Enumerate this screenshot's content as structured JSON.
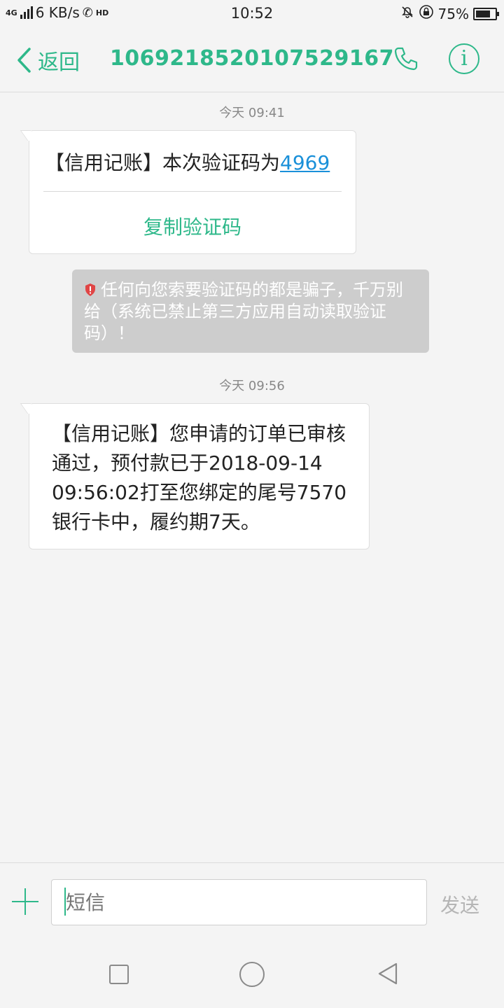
{
  "status_bar": {
    "network": "4G",
    "speed": "6 KB/s",
    "hd": "HD",
    "time": "10:52",
    "battery": "75%",
    "battery_level": 0.75
  },
  "header": {
    "back_label": "返回",
    "title": "106921852010752916​7",
    "accent_color": "#2eb88a"
  },
  "messages": [
    {
      "timestamp": "今天 09:41",
      "text": "【信用记账】本次验证码为",
      "code": "4969",
      "action": "复制验证码"
    },
    {
      "warning": "任何向您索要验证码的都是骗子，千万别给（系统已禁止第三方应用自动读取验证码）！"
    },
    {
      "timestamp": "今天 09:56",
      "text": "【信用记账】您申请的订单已审核通过，预付款已于2018-09-14 09:56:02打至您绑定的尾号7570银行卡中，履约期7天。"
    }
  ],
  "composer": {
    "placeholder": "短信",
    "send_label": "发送"
  },
  "icons": [
    "back-chevron-icon",
    "phone-icon",
    "info-icon",
    "shield-icon",
    "plus-icon",
    "nav-recent-icon",
    "nav-home-icon",
    "nav-back-icon"
  ]
}
